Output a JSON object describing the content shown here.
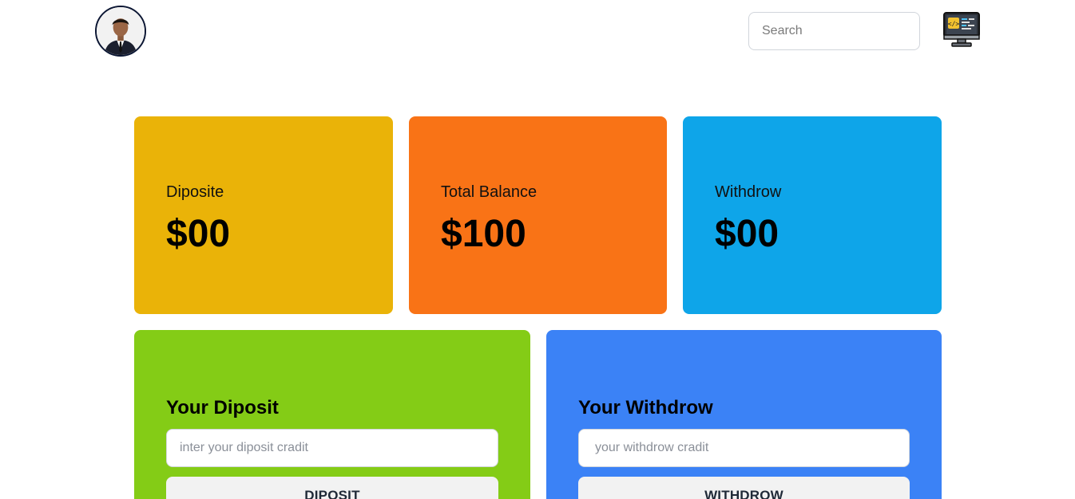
{
  "header": {
    "avatar_icon": "profile-photo",
    "search_placeholder": "Search",
    "app_icon": "developer-monitor-icon"
  },
  "cards": {
    "deposit": {
      "label": "Diposite",
      "amount": "$00",
      "color": "#eab308"
    },
    "balance": {
      "label": "Total Balance",
      "amount": "$100",
      "color": "#f97316"
    },
    "withdraw": {
      "label": "Withdrow",
      "amount": "$00",
      "color": "#0ea5e9"
    }
  },
  "deposit_panel": {
    "title": "Your Diposit",
    "input_placeholder": "inter your diposit cradit",
    "button_label": "DIPOSIT",
    "color": "#84cc16"
  },
  "withdraw_panel": {
    "title": "Your Withdrow",
    "input_placeholder": "your withdrow cradit",
    "button_label": "WITHDROW",
    "color": "#3b82f6"
  }
}
